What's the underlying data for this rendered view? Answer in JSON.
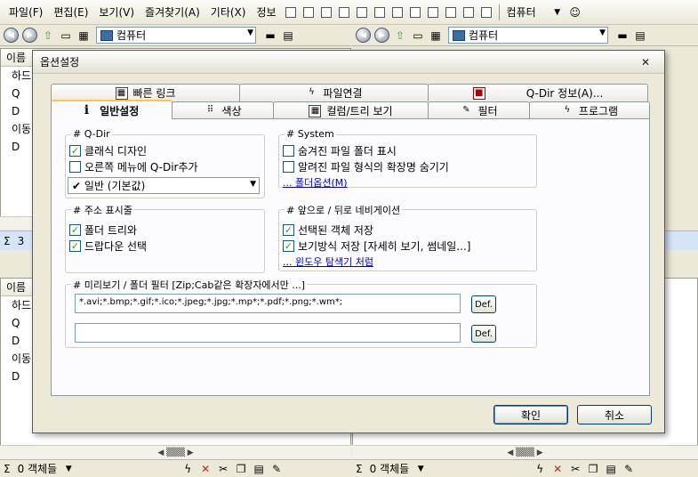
{
  "menubar": {
    "items": [
      "파일(F)",
      "편집(E)",
      "보기(V)",
      "즐겨찾기(A)",
      "기타(X)",
      "정보"
    ],
    "right_label": "컴퓨터"
  },
  "navbar": {
    "address": "컴퓨터"
  },
  "left_top_pane": {
    "column_header": "이름",
    "rows": [
      "하드",
      "Q",
      "D",
      "이동",
      "D"
    ]
  },
  "left_bottom_pane": {
    "column_header": "이름",
    "rows": [
      "하드",
      "Q",
      "D",
      "이동",
      "D"
    ]
  },
  "middle_status": {
    "sigma": "Σ",
    "count": "3"
  },
  "bottom_status": {
    "left_text": "0 객체들",
    "right_text": "0 객체들",
    "sigma": "Σ"
  },
  "dialog": {
    "title": "옵션설정",
    "close_label": "✕",
    "tabs_back": [
      {
        "label": "빠른 링크"
      },
      {
        "label": "파일연결"
      },
      {
        "label": "Q-Dir 정보(A)..."
      }
    ],
    "tabs_front": [
      {
        "label": "일반설정",
        "icon": "i"
      },
      {
        "label": "색상"
      },
      {
        "label": "컬럼/트리 보기"
      },
      {
        "label": "필터"
      },
      {
        "label": "프로그램"
      }
    ],
    "groups": {
      "qdir": {
        "title": "# Q-Dir",
        "options": [
          {
            "label": "클래식 디자인",
            "checked": true
          },
          {
            "label": "오른쪽 메뉴에 Q-Dir추가",
            "checked": false
          }
        ],
        "select_value": "✔ 일반 (기본값)"
      },
      "system": {
        "title": "# System",
        "options": [
          {
            "label": "숨겨진 파일 폴더 표시",
            "checked": false
          },
          {
            "label": "알려진 파일 형식의 확장명 숨기기",
            "checked": false
          }
        ],
        "link": "... 폴더옵션(M)"
      },
      "address_bar": {
        "title": "# 주소 표시줄",
        "options": [
          {
            "label": "폴더 트리와",
            "checked": true
          },
          {
            "label": "드랍다운 선택",
            "checked": true
          }
        ]
      },
      "navigation": {
        "title": "# 앞으로 / 뒤로 네비게이션",
        "options": [
          {
            "label": "선택된 객체 저장",
            "checked": true
          },
          {
            "label": "보기방식 저장 [자세히 보기, 썸네일...]",
            "checked": true
          }
        ],
        "link": "... 윈도우 탐색기 처럼"
      },
      "preview": {
        "title": "# 미리보기 / 폴더 필터 [Zip;Cab같은 확장자에서만 ...]",
        "input1_value": "*.avi;*.bmp;*.gif;*.ico;*.jpeg;*.jpg;*.mp*;*.pdf;*.png;*.wm*;",
        "input2_value": "",
        "def_label": "Def."
      }
    },
    "ok_label": "확인",
    "cancel_label": "취소"
  }
}
